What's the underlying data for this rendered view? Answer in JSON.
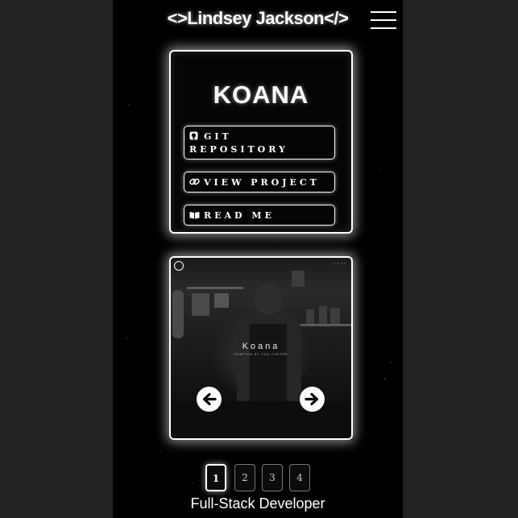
{
  "header": {
    "logo_text": "<>Lindsey Jackson</>",
    "menu_icon": "hamburger-menu-icon"
  },
  "project": {
    "title": "KOANA",
    "links": [
      {
        "label": "GIT REPOSITORY",
        "icon": "github-icon"
      },
      {
        "label": "VIEW PROJECT",
        "icon": "link-icon"
      },
      {
        "label": "READ ME",
        "icon": "book-icon"
      }
    ]
  },
  "preview": {
    "site_wordmark": "Koana",
    "site_tagline": "CRAFTED BY YOU COFFEE",
    "prev_icon": "arrow-left-icon",
    "next_icon": "arrow-right-icon"
  },
  "pagination": {
    "pages": [
      "1",
      "2",
      "3",
      "4"
    ],
    "active": "1"
  },
  "footer": {
    "role": "Full-Stack Developer"
  },
  "colors": {
    "background": "#000000",
    "page_outer": "#222224",
    "glow": "#ffffff"
  }
}
